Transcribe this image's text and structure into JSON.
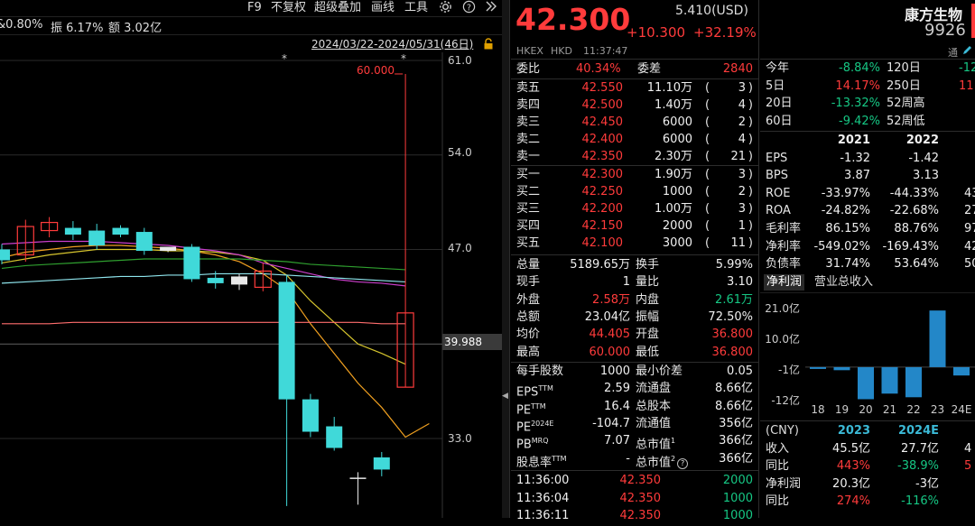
{
  "colors": {
    "up": "#ff3b3b",
    "down": "#16c784",
    "accent": "#3bb9d6",
    "bg": "#000000"
  },
  "topbar": {
    "amplitude_partial": "&0.80%",
    "amplitude": "振 6.17%",
    "turnover": "额 3.02亿",
    "menu": [
      "F9",
      "不复权",
      "超级叠加",
      "画线",
      "工具"
    ],
    "icons": [
      "gear-icon",
      "help-icon",
      "double-chevron-right-icon"
    ]
  },
  "chart": {
    "date_range": "2024/03/22-2024/05/31(46日)",
    "y_ticks": [
      "61.0",
      "54.0",
      "47.0",
      "40.0",
      "33.0"
    ],
    "peak_label": "60.000",
    "cursor_price": "39.988",
    "stars": [
      "*",
      "*"
    ]
  },
  "chart_data": {
    "type": "candlestick",
    "ylim": [
      29,
      61
    ],
    "y_ticks": [
      61.0,
      54.0,
      47.0,
      40.0,
      33.0
    ],
    "candles": [
      {
        "open": 47.0,
        "close": 46.2,
        "high": 47.4,
        "low": 45.9,
        "color": "cyan"
      },
      {
        "open": 46.6,
        "close": 48.7,
        "high": 49.2,
        "low": 46.1,
        "color": "red"
      },
      {
        "open": 48.4,
        "close": 49.0,
        "high": 49.4,
        "low": 47.9,
        "color": "red"
      },
      {
        "open": 48.1,
        "close": 48.6,
        "high": 49.1,
        "low": 47.7,
        "color": "cyan"
      },
      {
        "open": 48.4,
        "close": 47.3,
        "high": 48.9,
        "low": 47.0,
        "color": "cyan"
      },
      {
        "open": 48.1,
        "close": 48.6,
        "high": 48.8,
        "low": 47.9,
        "color": "cyan"
      },
      {
        "open": 48.3,
        "close": 46.9,
        "high": 48.6,
        "low": 46.6,
        "color": "cyan"
      },
      {
        "open": 46.9,
        "close": 47.2,
        "high": 47.2,
        "low": 46.8,
        "color": "white"
      },
      {
        "open": 47.2,
        "close": 44.8,
        "high": 47.4,
        "low": 44.6,
        "color": "cyan"
      },
      {
        "open": 44.9,
        "close": 44.5,
        "high": 45.4,
        "low": 44.1,
        "color": "cyan"
      },
      {
        "open": 45.0,
        "close": 44.4,
        "high": 45.2,
        "low": 44.0,
        "color": "white"
      },
      {
        "open": 44.2,
        "close": 45.4,
        "high": 46.0,
        "low": 43.9,
        "color": "red"
      },
      {
        "open": 44.6,
        "close": 35.9,
        "high": 45.1,
        "low": 21.0,
        "color": "cyan"
      },
      {
        "open": 35.9,
        "close": 33.5,
        "high": 36.3,
        "low": 33.1,
        "color": "cyan"
      },
      {
        "open": 33.9,
        "close": 32.3,
        "high": 34.6,
        "low": 32.1,
        "color": "cyan"
      },
      {
        "open": 30.1,
        "close": 30.1,
        "high": 30.5,
        "low": 28.1,
        "color": "white"
      },
      {
        "open": 30.7,
        "close": 31.6,
        "high": 32.0,
        "low": 30.2,
        "color": "cyan"
      },
      {
        "open": 36.8,
        "close": 42.3,
        "high": 60.0,
        "low": 36.8,
        "color": "red"
      }
    ],
    "ma_lines": [
      {
        "color": "#f0a020",
        "values": [
          46.4,
          46.8,
          47.0,
          47.2,
          47.3,
          47.3,
          47.2,
          47.1,
          46.9,
          46.6,
          46.1,
          45.2,
          44.0,
          41.5,
          39.3,
          37.1,
          35.3,
          33.1,
          34.1
        ]
      },
      {
        "color": "#d6c52e",
        "values": [
          46.0,
          46.3,
          46.6,
          46.8,
          47.0,
          47.0,
          47.0,
          46.9,
          46.9,
          46.8,
          46.6,
          46.2,
          45.1,
          43.2,
          41.6,
          40.0,
          39.3,
          38.5
        ]
      },
      {
        "color": "#cc3fcc",
        "values": [
          47.4,
          47.5,
          47.6,
          47.6,
          47.6,
          47.5,
          47.4,
          47.3,
          47.1,
          46.9,
          46.6,
          46.0,
          45.6,
          45.2,
          44.8,
          44.6,
          44.5,
          44.3
        ]
      },
      {
        "color": "#2fa02f",
        "values": [
          45.6,
          45.8,
          45.9,
          46.0,
          46.1,
          46.2,
          46.3,
          46.3,
          46.3,
          46.3,
          46.3,
          46.2,
          46.1,
          45.9,
          45.8,
          45.7,
          45.6,
          45.5
        ]
      },
      {
        "color": "#8fe6ee",
        "values": [
          44.5,
          44.6,
          44.7,
          44.8,
          44.9,
          45.0,
          45.0,
          45.1,
          45.1,
          45.2,
          45.2,
          45.2,
          45.1,
          45.0,
          44.9,
          44.8,
          44.7,
          44.6
        ]
      },
      {
        "color": "#ff6e6e",
        "values": [
          41.5,
          41.5,
          41.5,
          41.6,
          41.6,
          41.6,
          41.6,
          41.6,
          41.6,
          41.6,
          41.6,
          41.6,
          41.6,
          41.6,
          41.6,
          41.6,
          41.5,
          41.5
        ]
      }
    ]
  },
  "quote": {
    "price": "42.300",
    "usd": "5.410(USD)",
    "change": "+10.300",
    "change_pct": "+32.19%",
    "name": "康方生物",
    "code": "9926",
    "exchange": "HKEX",
    "currency": "HKD",
    "time": "11:37:47",
    "tong": "通"
  },
  "orderbook": {
    "ratio_label": "委比",
    "ratio": "40.34%",
    "diff_label": "委差",
    "diff": "2840",
    "asks": [
      {
        "label": "卖五",
        "price": "42.550",
        "vol": "11.10万",
        "orders": "3"
      },
      {
        "label": "卖四",
        "price": "42.500",
        "vol": "1.40万",
        "orders": "4"
      },
      {
        "label": "卖三",
        "price": "42.450",
        "vol": "6000",
        "orders": "2"
      },
      {
        "label": "卖二",
        "price": "42.400",
        "vol": "6000",
        "orders": "4"
      },
      {
        "label": "卖一",
        "price": "42.350",
        "vol": "2.30万",
        "orders": "21"
      }
    ],
    "bids": [
      {
        "label": "买一",
        "price": "42.300",
        "vol": "1.90万",
        "orders": "3"
      },
      {
        "label": "买二",
        "price": "42.250",
        "vol": "1000",
        "orders": "2"
      },
      {
        "label": "买三",
        "price": "42.200",
        "vol": "1.00万",
        "orders": "3"
      },
      {
        "label": "买四",
        "price": "42.150",
        "vol": "2000",
        "orders": "1"
      },
      {
        "label": "买五",
        "price": "42.100",
        "vol": "3000",
        "orders": "11"
      }
    ]
  },
  "stats": [
    {
      "l1": "总量",
      "v1": "5189.65万",
      "c1": "white",
      "l2": "换手",
      "v2": "5.99%",
      "c2": "white"
    },
    {
      "l1": "现手",
      "v1": "1",
      "c1": "white",
      "l2": "量比",
      "v2": "3.10",
      "c2": "white"
    },
    {
      "l1": "外盘",
      "v1": "2.58万",
      "c1": "red",
      "l2": "内盘",
      "v2": "2.61万",
      "c2": "green"
    },
    {
      "l1": "总额",
      "v1": "23.04亿",
      "c1": "white",
      "l2": "振幅",
      "v2": "72.50%",
      "c2": "white"
    },
    {
      "l1": "均价",
      "v1": "44.405",
      "c1": "red",
      "l2": "开盘",
      "v2": "36.800",
      "c2": "red"
    },
    {
      "l1": "最高",
      "v1": "60.000",
      "c1": "red",
      "l2": "最低",
      "v2": "36.800",
      "c2": "red"
    }
  ],
  "stats2": [
    {
      "l1": "每手股数",
      "v1": "1000",
      "l2": "最小价差",
      "v2": "0.05"
    },
    {
      "l1": "EPS",
      "s1": "TTM",
      "v1": "2.59",
      "l2": "流通盘",
      "v2": "8.66亿"
    },
    {
      "l1": "PE",
      "s1": "TTM",
      "v1": "16.4",
      "l2": "总股本",
      "v2": "8.66亿"
    },
    {
      "l1": "PE",
      "s1": "2024E",
      "v1": "-104.7",
      "l2": "流通值",
      "v2": "356亿"
    },
    {
      "l1": "PB",
      "s1": "MRQ",
      "v1": "7.07",
      "l2": "总市值",
      "s2": "1",
      "v2": "366亿"
    },
    {
      "l1": "股息率",
      "s1": "TTM",
      "v1": "-",
      "l2": "总市值",
      "s2": "2",
      "v2": "366亿"
    }
  ],
  "ticks": [
    {
      "time": "11:36:00",
      "price": "42.350",
      "vol": "2000"
    },
    {
      "time": "11:36:04",
      "price": "42.350",
      "vol": "1000"
    },
    {
      "time": "11:36:11",
      "price": "42.350",
      "vol": "1000"
    }
  ],
  "perf": [
    {
      "l1": "今年",
      "v1": "-8.84%",
      "c1": "green",
      "l2": "120日",
      "v2": "-12",
      "c2": "green"
    },
    {
      "l1": "5日",
      "v1": "14.17%",
      "c1": "red",
      "l2": "250日",
      "v2": "11",
      "c2": "red"
    },
    {
      "l1": "20日",
      "v1": "-13.32%",
      "c1": "green",
      "l2": "52周高",
      "v2": "",
      "c2": "white"
    },
    {
      "l1": "60日",
      "v1": "-9.42%",
      "c1": "green",
      "l2": "52周低",
      "v2": "",
      "c2": "white"
    }
  ],
  "fin": {
    "years": [
      "2021",
      "2022"
    ],
    "rows": [
      {
        "label": "EPS",
        "a": "-1.32",
        "b": "-1.42",
        "c": ""
      },
      {
        "label": "BPS",
        "a": "3.87",
        "b": "3.13",
        "c": ""
      },
      {
        "label": "ROE",
        "a": "-33.97%",
        "b": "-44.33%",
        "c": "43"
      },
      {
        "label": "ROA",
        "a": "-24.82%",
        "b": "-22.68%",
        "c": "27"
      },
      {
        "label": "毛利率",
        "a": "86.15%",
        "b": "88.76%",
        "c": "97"
      },
      {
        "label": "净利率",
        "a": "-549.02%",
        "b": "-169.43%",
        "c": "42"
      },
      {
        "label": "负债率",
        "a": "31.74%",
        "b": "53.64%",
        "c": "50"
      }
    ]
  },
  "profit_tabs": [
    "净利润",
    "营业总收入"
  ],
  "profit_chart": {
    "y_ticks": [
      "21.0亿",
      "10.0亿",
      "-1亿",
      "-12亿"
    ],
    "x_labels": [
      "18",
      "19",
      "20",
      "21",
      "22",
      "23",
      "24E"
    ]
  },
  "profit_chart_data": {
    "type": "bar",
    "categories": [
      "18",
      "19",
      "20",
      "21",
      "22",
      "23",
      "24E"
    ],
    "values": [
      -0.5,
      -1.1,
      -11.5,
      -9.5,
      -10.8,
      20.3,
      -3.0
    ],
    "ylim": [
      -12,
      21
    ]
  },
  "forecast": {
    "header": [
      "(CNY)",
      "2023",
      "2024E",
      ""
    ],
    "rows": [
      {
        "label": "收入",
        "a": "45.5亿",
        "ac": "white",
        "b": "27.7亿",
        "bc": "white",
        "c": "4",
        "cc": "white"
      },
      {
        "label": "同比",
        "a": "443%",
        "ac": "red",
        "b": "-38.9%",
        "bc": "green",
        "c": "5",
        "cc": "red"
      },
      {
        "label": "净利润",
        "a": "20.3亿",
        "ac": "white",
        "b": "-3亿",
        "bc": "white",
        "c": "",
        "cc": "white"
      },
      {
        "label": "同比",
        "a": "274%",
        "ac": "red",
        "b": "-116%",
        "bc": "green",
        "c": "",
        "cc": "white"
      }
    ]
  }
}
